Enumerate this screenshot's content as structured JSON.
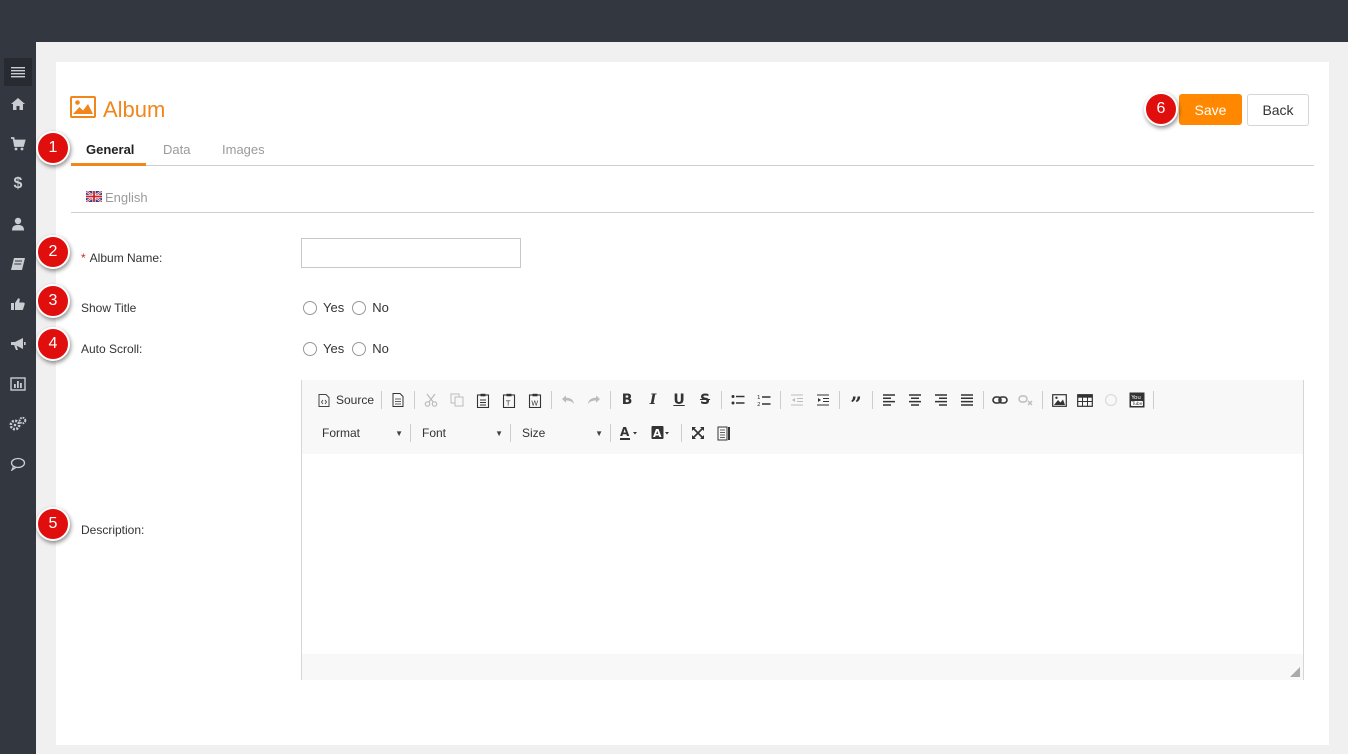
{
  "sidebar": {
    "items": [
      {
        "icon": "menu-icon"
      },
      {
        "icon": "home-icon"
      },
      {
        "icon": "cart-icon"
      },
      {
        "icon": "dollar-icon"
      },
      {
        "icon": "user-icon"
      },
      {
        "icon": "book-icon"
      },
      {
        "icon": "thumbs-up-icon"
      },
      {
        "icon": "megaphone-icon"
      },
      {
        "icon": "bar-chart-icon"
      },
      {
        "icon": "gears-icon"
      },
      {
        "icon": "chat-icon"
      }
    ]
  },
  "page": {
    "title": "Album",
    "save_label": "Save",
    "back_label": "Back"
  },
  "tabs": [
    {
      "label": "General",
      "active": true
    },
    {
      "label": "Data",
      "active": false
    },
    {
      "label": "Images",
      "active": false
    }
  ],
  "language": {
    "label": "English"
  },
  "form": {
    "album_name": {
      "required_mark": "*",
      "label": "Album Name:",
      "value": ""
    },
    "show_title": {
      "label": "Show Title",
      "options": [
        "Yes",
        "No"
      ]
    },
    "auto_scroll": {
      "label": "Auto Scroll:",
      "options": [
        "Yes",
        "No"
      ]
    },
    "description": {
      "label": "Description:"
    }
  },
  "editor": {
    "source_label": "Source",
    "format_label": "Format",
    "font_label": "Font",
    "size_label": "Size"
  },
  "callouts": [
    "1",
    "2",
    "3",
    "4",
    "5",
    "6"
  ],
  "colors": {
    "accent": "#f0861c",
    "save": "#ff8800",
    "callout": "#e10e0e",
    "topbar": "#333840"
  }
}
